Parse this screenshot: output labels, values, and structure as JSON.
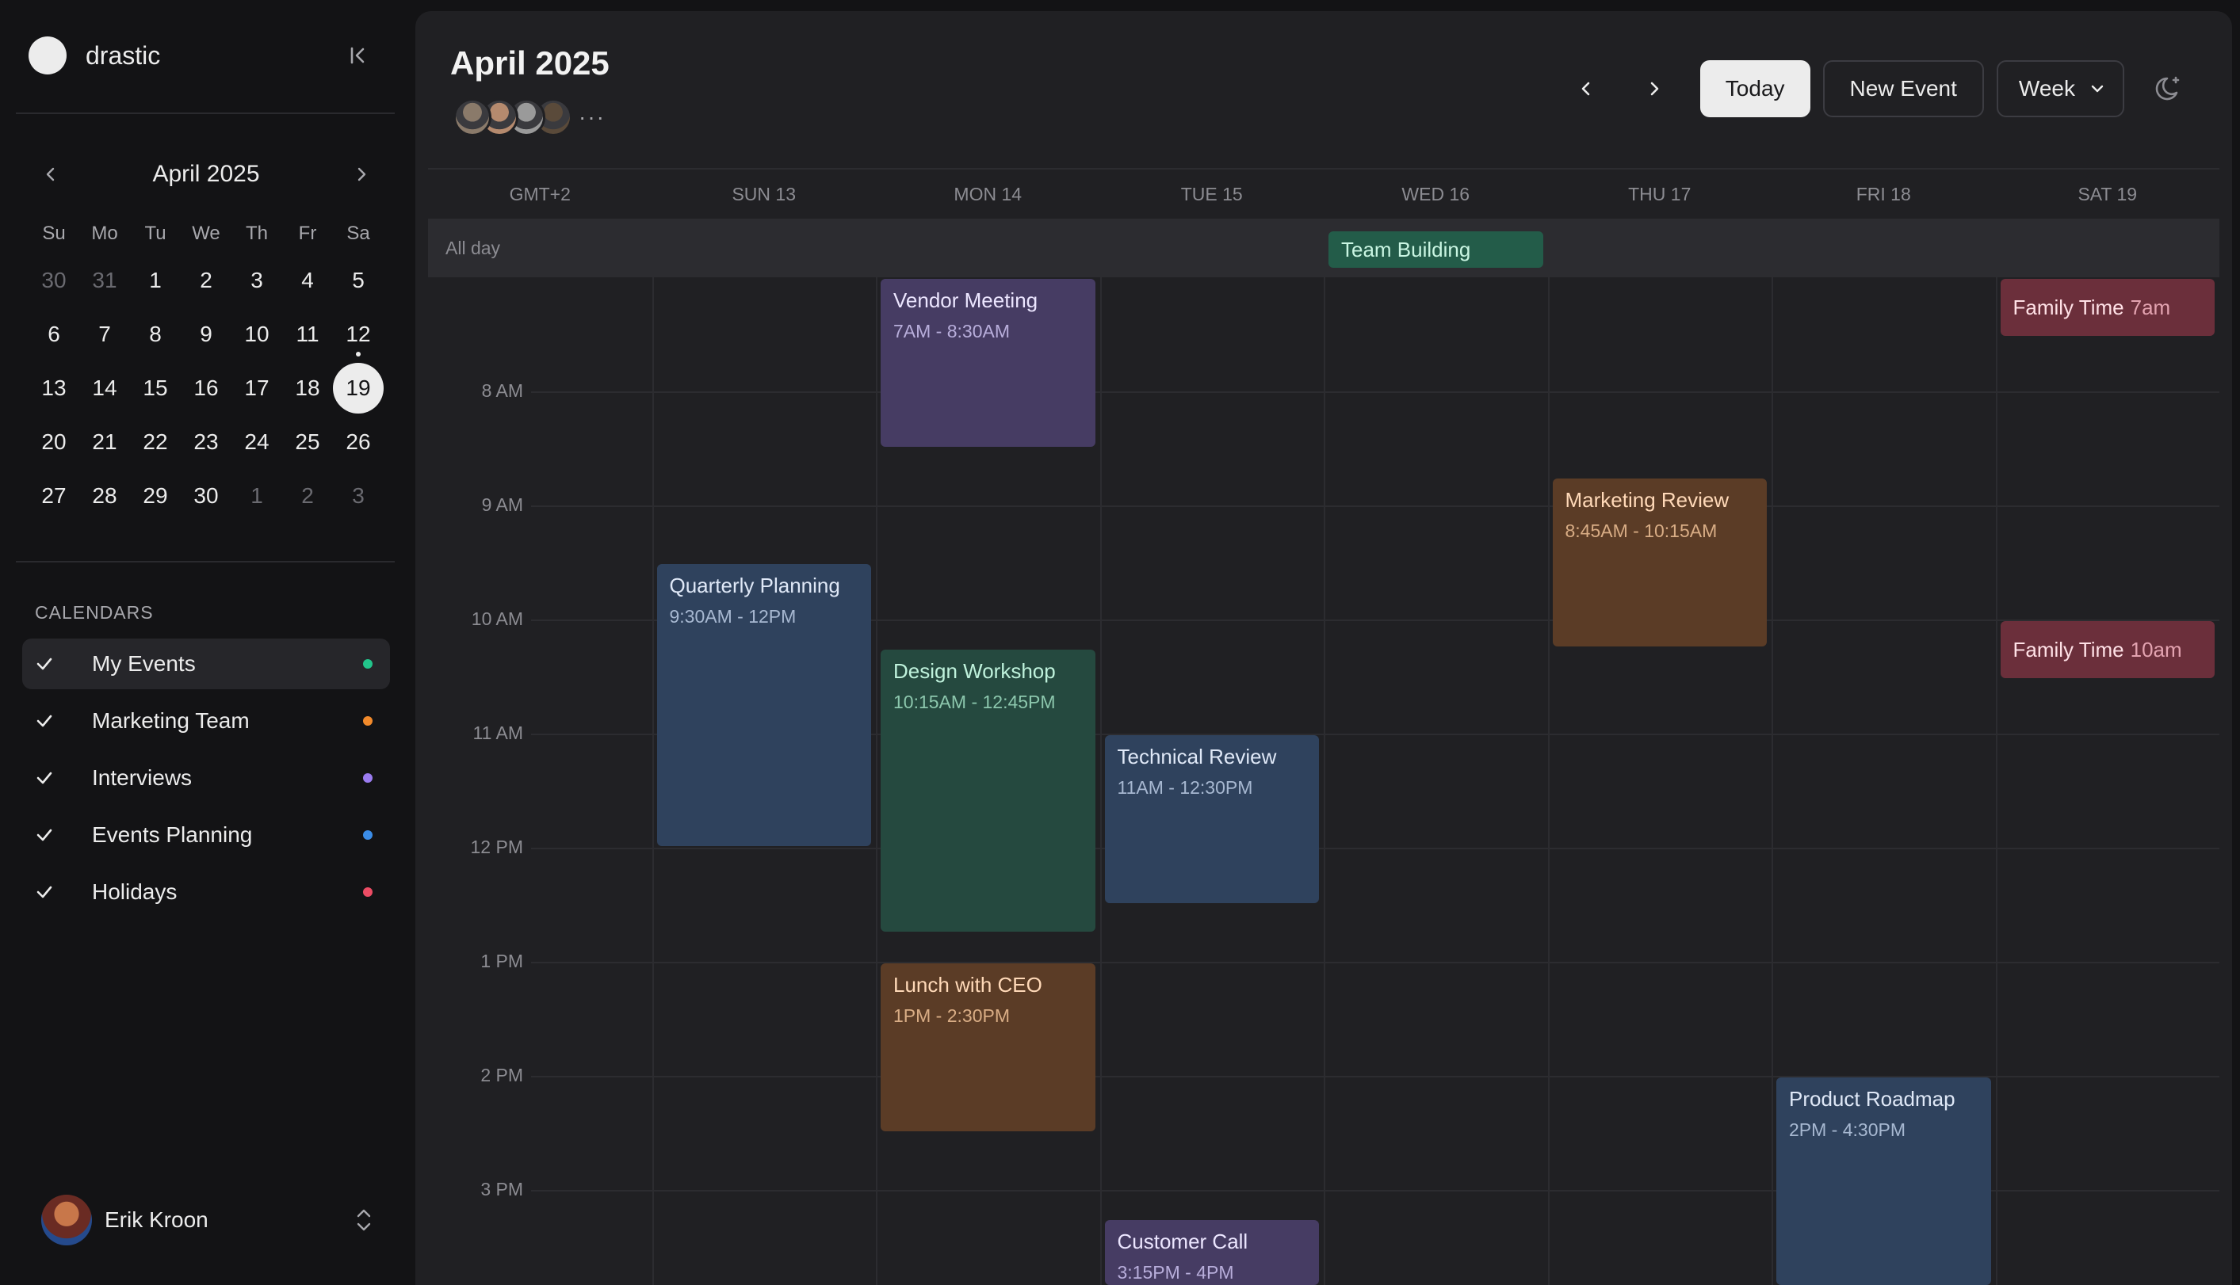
{
  "app": {
    "name": "drastic"
  },
  "mini_calendar": {
    "title": "April 2025",
    "weekdays": [
      "Su",
      "Mo",
      "Tu",
      "We",
      "Th",
      "Fr",
      "Sa"
    ],
    "days": [
      {
        "d": "30",
        "muted": true
      },
      {
        "d": "31",
        "muted": true
      },
      {
        "d": "1"
      },
      {
        "d": "2"
      },
      {
        "d": "3"
      },
      {
        "d": "4"
      },
      {
        "d": "5"
      },
      {
        "d": "6"
      },
      {
        "d": "7"
      },
      {
        "d": "8"
      },
      {
        "d": "9"
      },
      {
        "d": "10"
      },
      {
        "d": "11"
      },
      {
        "d": "12",
        "dot": true
      },
      {
        "d": "13"
      },
      {
        "d": "14"
      },
      {
        "d": "15"
      },
      {
        "d": "16"
      },
      {
        "d": "17"
      },
      {
        "d": "18"
      },
      {
        "d": "19",
        "today": true
      },
      {
        "d": "20"
      },
      {
        "d": "21"
      },
      {
        "d": "22"
      },
      {
        "d": "23"
      },
      {
        "d": "24"
      },
      {
        "d": "25"
      },
      {
        "d": "26"
      },
      {
        "d": "27"
      },
      {
        "d": "28"
      },
      {
        "d": "29"
      },
      {
        "d": "30"
      },
      {
        "d": "1",
        "muted": true
      },
      {
        "d": "2",
        "muted": true
      },
      {
        "d": "3",
        "muted": true
      }
    ]
  },
  "calendars": {
    "title": "CALENDARS",
    "items": [
      {
        "label": "My Events",
        "color": "#22c58b",
        "checked": true,
        "active": true
      },
      {
        "label": "Marketing Team",
        "color": "#f28a2b",
        "checked": true
      },
      {
        "label": "Interviews",
        "color": "#9b7cf0",
        "checked": true
      },
      {
        "label": "Events Planning",
        "color": "#3b8de8",
        "checked": true
      },
      {
        "label": "Holidays",
        "color": "#ec4c64",
        "checked": true
      }
    ]
  },
  "user": {
    "name": "Erik Kroon"
  },
  "header": {
    "title": "April 2025",
    "attendee_colors": [
      "#8a7a6a",
      "#b58a6e",
      "#9a9a9a",
      "#5a4a3a"
    ],
    "more": "···",
    "today_label": "Today",
    "new_event_label": "New Event",
    "view_label": "Week"
  },
  "week": {
    "timezone": "GMT+2",
    "days": [
      "SUN 13",
      "MON 14",
      "TUE 15",
      "WED 16",
      "THU 17",
      "FRI 18",
      "SAT 19"
    ],
    "all_day_label": "All day",
    "hours": [
      "8 AM",
      "9 AM",
      "10 AM",
      "11 AM",
      "12 PM",
      "1 PM",
      "2 PM",
      "3 PM"
    ]
  },
  "all_day_events": [
    {
      "title": "Team Building",
      "day": 3,
      "color": "teal"
    }
  ],
  "events": [
    {
      "title": "Vendor Meeting",
      "time": "7AM - 8:30AM",
      "day": 1,
      "start": 7.0,
      "end": 8.5,
      "color": "purple"
    },
    {
      "title": "Family Time",
      "time": "7am",
      "day": 6,
      "start": 7.0,
      "end": 7.5,
      "color": "red",
      "inline": true
    },
    {
      "title": "Marketing Review",
      "time": "8:45AM - 10:15AM",
      "day": 4,
      "start": 8.75,
      "end": 10.25,
      "color": "brown"
    },
    {
      "title": "Quarterly Planning",
      "time": "9:30AM - 12PM",
      "day": 0,
      "start": 9.5,
      "end": 12.0,
      "color": "blue"
    },
    {
      "title": "Family Time",
      "time": "10am",
      "day": 6,
      "start": 10.0,
      "end": 10.5,
      "color": "red",
      "inline": true
    },
    {
      "title": "Design Workshop",
      "time": "10:15AM - 12:45PM",
      "day": 1,
      "start": 10.25,
      "end": 12.75,
      "color": "green"
    },
    {
      "title": "Technical Review",
      "time": "11AM - 12:30PM",
      "day": 2,
      "start": 11.0,
      "end": 12.5,
      "color": "blue"
    },
    {
      "title": "Lunch with CEO",
      "time": "1PM - 2:30PM",
      "day": 1,
      "start": 13.0,
      "end": 14.5,
      "color": "brown"
    },
    {
      "title": "Product Roadmap",
      "time": "2PM - 4:30PM",
      "day": 5,
      "start": 14.0,
      "end": 16.5,
      "color": "blue"
    },
    {
      "title": "Customer Call",
      "time": "3:15PM - 4PM",
      "day": 2,
      "start": 15.25,
      "end": 16.0,
      "color": "purple"
    }
  ]
}
